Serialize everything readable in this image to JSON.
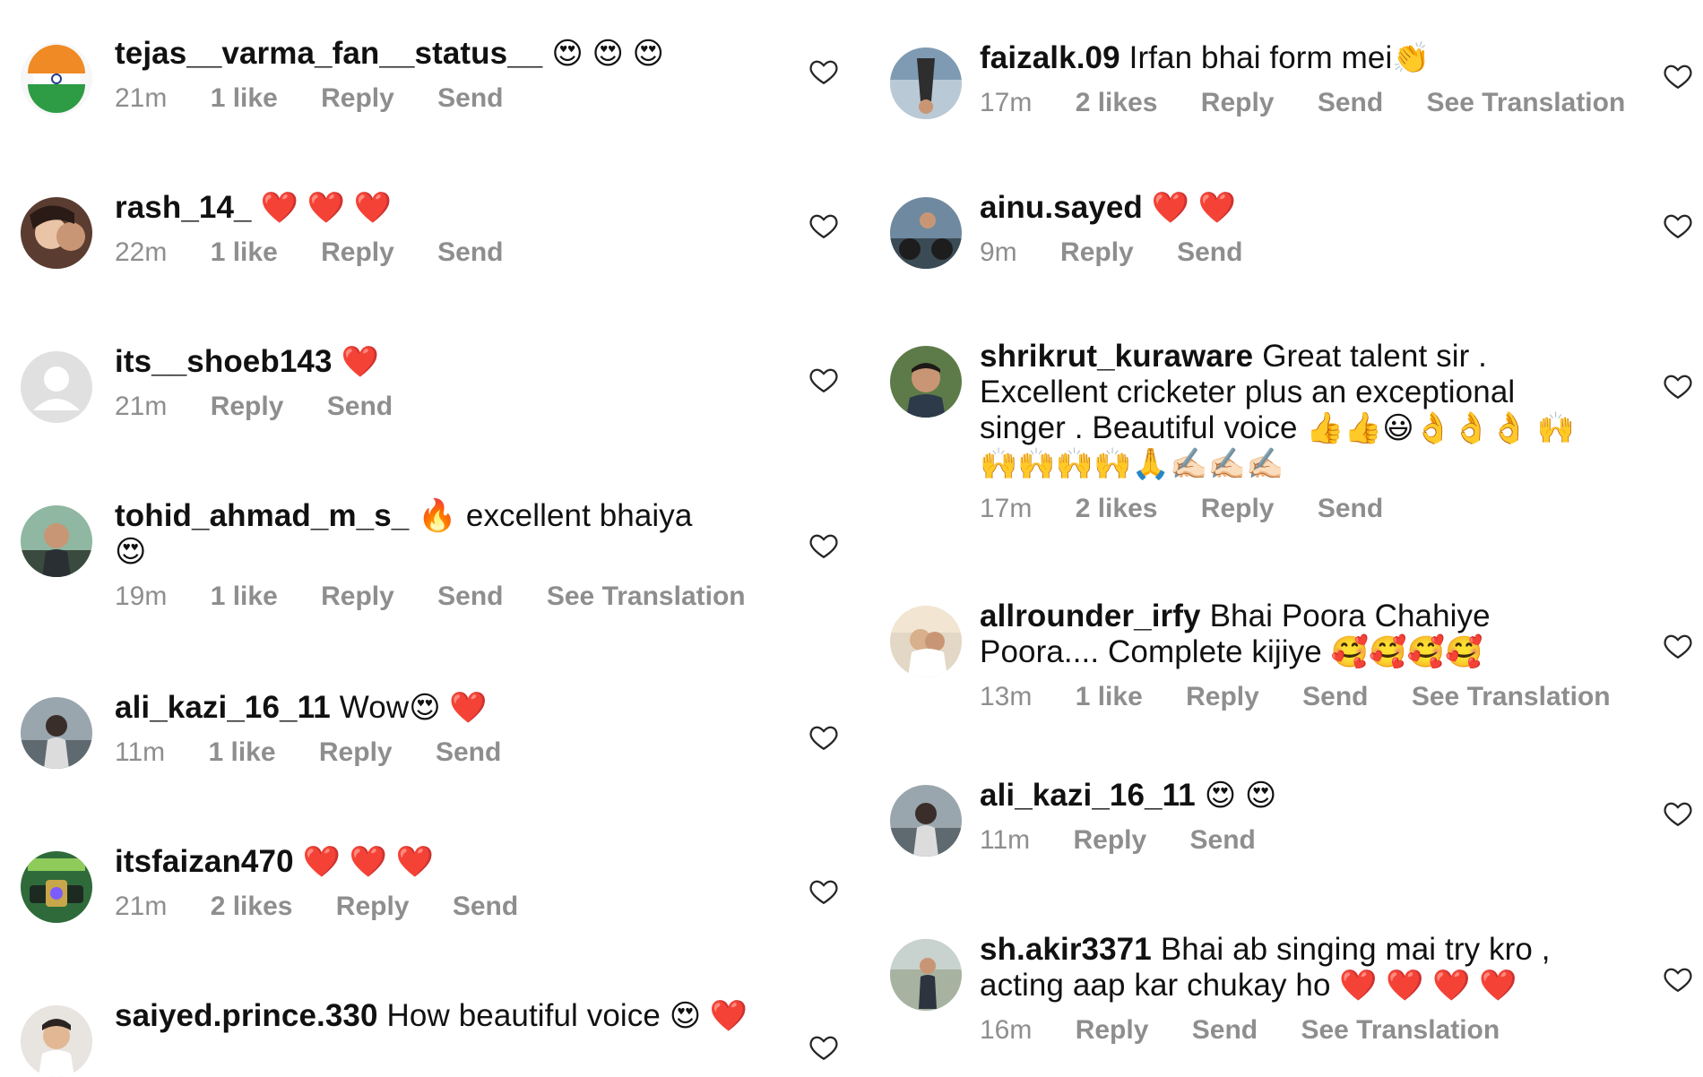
{
  "left": [
    {
      "username": "tejas__varma_fan__status__",
      "text": "",
      "emoji": "😍 😍 😍",
      "time": "21m",
      "likes": "1 like",
      "reply": "Reply",
      "send": "Send",
      "translation": "",
      "avatar_color": "#e6f0e6"
    },
    {
      "username": "rash_14_",
      "text": "",
      "emoji": "❤️ ❤️ ❤️",
      "time": "22m",
      "likes": "1 like",
      "reply": "Reply",
      "send": "Send",
      "translation": "",
      "avatar_color": "#6b4d3f"
    },
    {
      "username": "its__shoeb143",
      "text": "",
      "emoji": "❤️",
      "time": "21m",
      "likes": "",
      "reply": "Reply",
      "send": "Send",
      "translation": "",
      "avatar_color": "#dbdbdb"
    },
    {
      "username": "tohid_ahmad_m_s_",
      "text": "🔥 excellent bhaiya",
      "emoji": "😍",
      "time": "19m",
      "likes": "1 like",
      "reply": "Reply",
      "send": "Send",
      "translation": "See Translation",
      "avatar_color": "#3e5a4a"
    },
    {
      "username": "ali_kazi_16_11",
      "text": "Wow",
      "emoji": "😍 ❤️",
      "time": "11m",
      "likes": "1 like",
      "reply": "Reply",
      "send": "Send",
      "translation": "",
      "avatar_color": "#7e8b95"
    },
    {
      "username": "itsfaizan470",
      "text": "",
      "emoji": "❤️ ❤️ ❤️",
      "time": "21m",
      "likes": "2 likes",
      "reply": "Reply",
      "send": "Send",
      "translation": "",
      "avatar_color": "#2f6b3a"
    },
    {
      "username": "saiyed.prince.330",
      "text": "How beautiful voice",
      "emoji": "😍 ❤️",
      "time": "",
      "likes": "",
      "reply": "",
      "send": "",
      "translation": "",
      "avatar_color": "#c9c3bd"
    }
  ],
  "right": [
    {
      "username": "faizalk.09",
      "text": "Irfan bhai form mei",
      "emoji": "👏",
      "time": "17m",
      "likes": "2 likes",
      "reply": "Reply",
      "send": "Send",
      "translation": "See Translation",
      "avatar_color": "#8aa0b4"
    },
    {
      "username": "ainu.sayed",
      "text": "",
      "emoji": "❤️ ❤️",
      "time": "9m",
      "likes": "",
      "reply": "Reply",
      "send": "Send",
      "translation": "",
      "avatar_color": "#4b5f6d"
    },
    {
      "username": "shrikrut_kuraware",
      "text": "Great talent sir . Excellent cricketer plus an exceptional singer . Beautiful voice",
      "emoji": "👍👍😃👌👌👌 🙌🙌🙌🙌🙌🙏✍🏻✍🏻✍🏻",
      "time": "17m",
      "likes": "2 likes",
      "reply": "Reply",
      "send": "Send",
      "translation": "",
      "avatar_color": "#4f6a3f"
    },
    {
      "username": "allrounder_irfy",
      "text": "Bhai Poora Chahiye Poora.... Complete kijiye",
      "emoji": "🥰🥰🥰🥰",
      "time": "13m",
      "likes": "1 like",
      "reply": "Reply",
      "send": "Send",
      "translation": "See Translation",
      "avatar_color": "#d8c7b3"
    },
    {
      "username": "ali_kazi_16_11",
      "text": "",
      "emoji": "😍 😍",
      "time": "11m",
      "likes": "",
      "reply": "Reply",
      "send": "Send",
      "translation": "",
      "avatar_color": "#7e8b95"
    },
    {
      "username": "sh.akir3371",
      "text": "Bhai ab singing mai try kro , acting aap kar chukay ho",
      "emoji": "❤️ ❤️ ❤️ ❤️",
      "time": "16m",
      "likes": "",
      "reply": "Reply",
      "send": "Send",
      "translation": "See Translation",
      "avatar_color": "#8a8f7a"
    }
  ]
}
